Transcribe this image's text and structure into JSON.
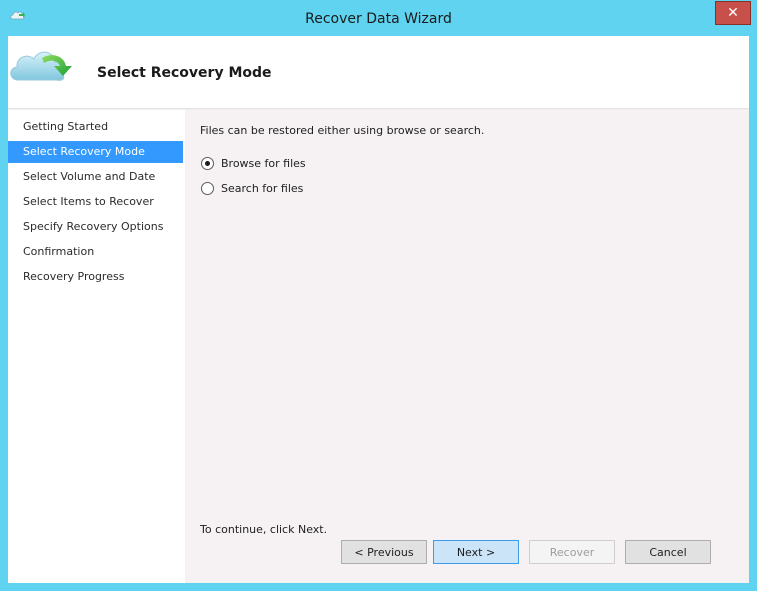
{
  "window": {
    "title": "Recover Data Wizard",
    "close_label": "✕",
    "accent_color": "#5fd3f0"
  },
  "header": {
    "title": "Select Recovery Mode",
    "icon": "cloud-restore-icon"
  },
  "nav": {
    "items": [
      {
        "label": "Getting Started",
        "active": false
      },
      {
        "label": "Select Recovery Mode",
        "active": true
      },
      {
        "label": "Select Volume and Date",
        "active": false
      },
      {
        "label": "Select Items to Recover",
        "active": false
      },
      {
        "label": "Specify Recovery Options",
        "active": false
      },
      {
        "label": "Confirmation",
        "active": false
      },
      {
        "label": "Recovery Progress",
        "active": false
      }
    ],
    "active_color": "#3399ff"
  },
  "content": {
    "intro": "Files can be restored either using browse or search.",
    "options": [
      {
        "label": "Browse for files",
        "selected": true
      },
      {
        "label": "Search for files",
        "selected": false
      }
    ],
    "continue_text": "To continue, click Next."
  },
  "buttons": {
    "previous": "< Previous",
    "next": "Next >",
    "recover": "Recover",
    "cancel": "Cancel"
  }
}
